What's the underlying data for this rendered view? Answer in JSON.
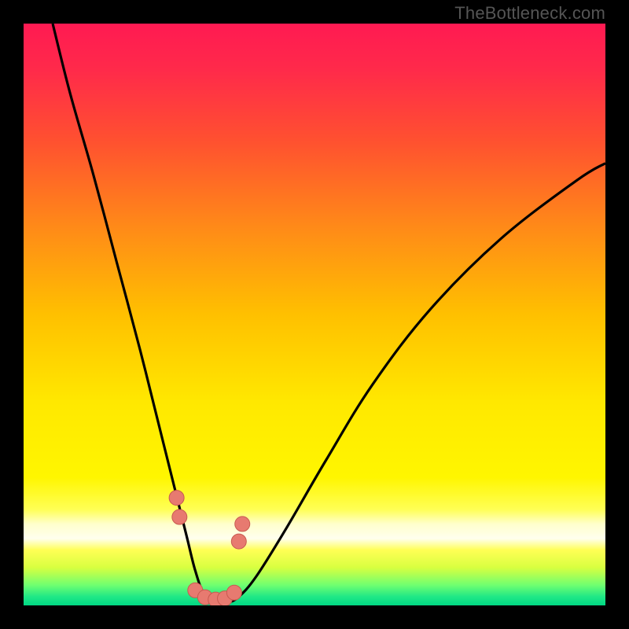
{
  "watermark": "TheBottleneck.com",
  "colors": {
    "frame": "#000000",
    "gradient_stops": [
      {
        "offset": 0.0,
        "color": "#ff1a52"
      },
      {
        "offset": 0.08,
        "color": "#ff2a4a"
      },
      {
        "offset": 0.2,
        "color": "#ff5030"
      },
      {
        "offset": 0.35,
        "color": "#ff8a18"
      },
      {
        "offset": 0.5,
        "color": "#ffc000"
      },
      {
        "offset": 0.65,
        "color": "#ffe800"
      },
      {
        "offset": 0.78,
        "color": "#fff600"
      },
      {
        "offset": 0.835,
        "color": "#ffff55"
      },
      {
        "offset": 0.86,
        "color": "#ffffcc"
      },
      {
        "offset": 0.885,
        "color": "#ffffee"
      },
      {
        "offset": 0.905,
        "color": "#ffff55"
      },
      {
        "offset": 0.935,
        "color": "#d8ff40"
      },
      {
        "offset": 0.965,
        "color": "#70ff70"
      },
      {
        "offset": 0.985,
        "color": "#20e886"
      },
      {
        "offset": 1.0,
        "color": "#00d884"
      }
    ],
    "curve_stroke": "#000000",
    "marker_fill": "#e77a70",
    "marker_stroke": "#c85a50"
  },
  "chart_data": {
    "type": "line",
    "title": "",
    "xlabel": "",
    "ylabel": "",
    "xlim": [
      0,
      100
    ],
    "ylim": [
      0,
      100
    ],
    "series": [
      {
        "name": "bottleneck-curve",
        "x": [
          5,
          8,
          12,
          16,
          20,
          24,
          26,
          28,
          29.5,
          31,
          33,
          35,
          37,
          40,
          45,
          52,
          60,
          70,
          82,
          95,
          100
        ],
        "y": [
          100,
          88,
          74,
          59,
          44,
          28,
          20,
          12,
          6,
          2,
          0.5,
          0.5,
          1.5,
          5,
          13,
          25,
          38,
          51,
          63,
          73,
          76
        ]
      }
    ],
    "markers": {
      "name": "highlight-points",
      "x": [
        26.3,
        26.8,
        29.5,
        31.2,
        33.0,
        34.6,
        36.2,
        37.0,
        37.6
      ],
      "y": [
        18.5,
        15.2,
        2.6,
        1.4,
        1.0,
        1.2,
        2.2,
        11.0,
        14.0
      ]
    }
  }
}
